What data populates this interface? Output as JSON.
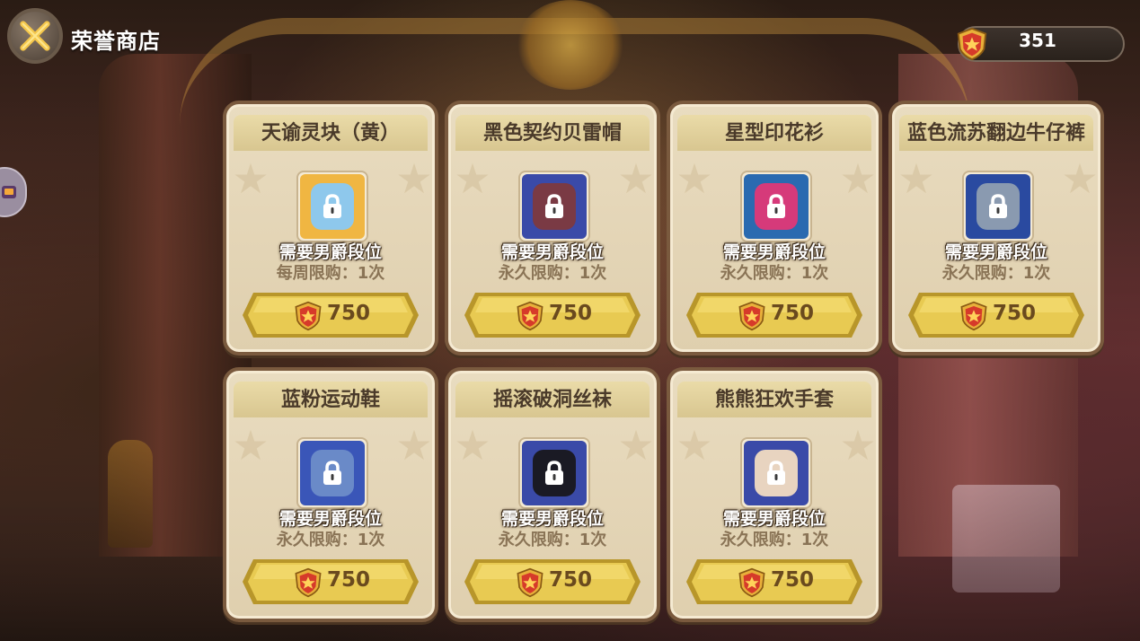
{
  "header": {
    "title": "荣誉商店",
    "currency_value": "351"
  },
  "items": [
    {
      "name": "天谕灵块（黄）",
      "requirement": "需要男爵段位",
      "limit": "每周限购：1次",
      "price": "750",
      "icon": "blue-crystal-icon",
      "icon_bg": "#f0b642",
      "item_color": "#8ec8ec"
    },
    {
      "name": "黑色契约贝雷帽",
      "requirement": "需要男爵段位",
      "limit": "永久限购：1次",
      "price": "750",
      "icon": "black-beret-icon",
      "icon_bg": "#3a4aa8",
      "item_color": "#7a3a44"
    },
    {
      "name": "星型印花衫",
      "requirement": "需要男爵段位",
      "limit": "永久限购：1次",
      "price": "750",
      "icon": "pink-shirt-icon",
      "icon_bg": "#2a6ab0",
      "item_color": "#d63a7a"
    },
    {
      "name": "蓝色流苏翻边牛仔裤",
      "requirement": "需要男爵段位",
      "limit": "永久限购：1次",
      "price": "750",
      "icon": "denim-jeans-icon",
      "icon_bg": "#2a4aa0",
      "item_color": "#8a9ab0"
    },
    {
      "name": "蓝粉运动鞋",
      "requirement": "需要男爵段位",
      "limit": "永久限购：1次",
      "price": "750",
      "icon": "sneakers-icon",
      "icon_bg": "#3a56b8",
      "item_color": "#6a8ac8"
    },
    {
      "name": "摇滚破洞丝袜",
      "requirement": "需要男爵段位",
      "limit": "永久限购：1次",
      "price": "750",
      "icon": "ripped-stockings-icon",
      "icon_bg": "#3a4aa8",
      "item_color": "#1a1a24"
    },
    {
      "name": "熊熊狂欢手套",
      "requirement": "需要男爵段位",
      "limit": "永久限购：1次",
      "price": "750",
      "icon": "bear-gloves-icon",
      "icon_bg": "#3a4aa8",
      "item_color": "#e8d4c0"
    }
  ],
  "colors": {
    "card_border": "#7a5a3e",
    "button_gold": "#e2c24a",
    "badge_red": "#d63a2a"
  }
}
